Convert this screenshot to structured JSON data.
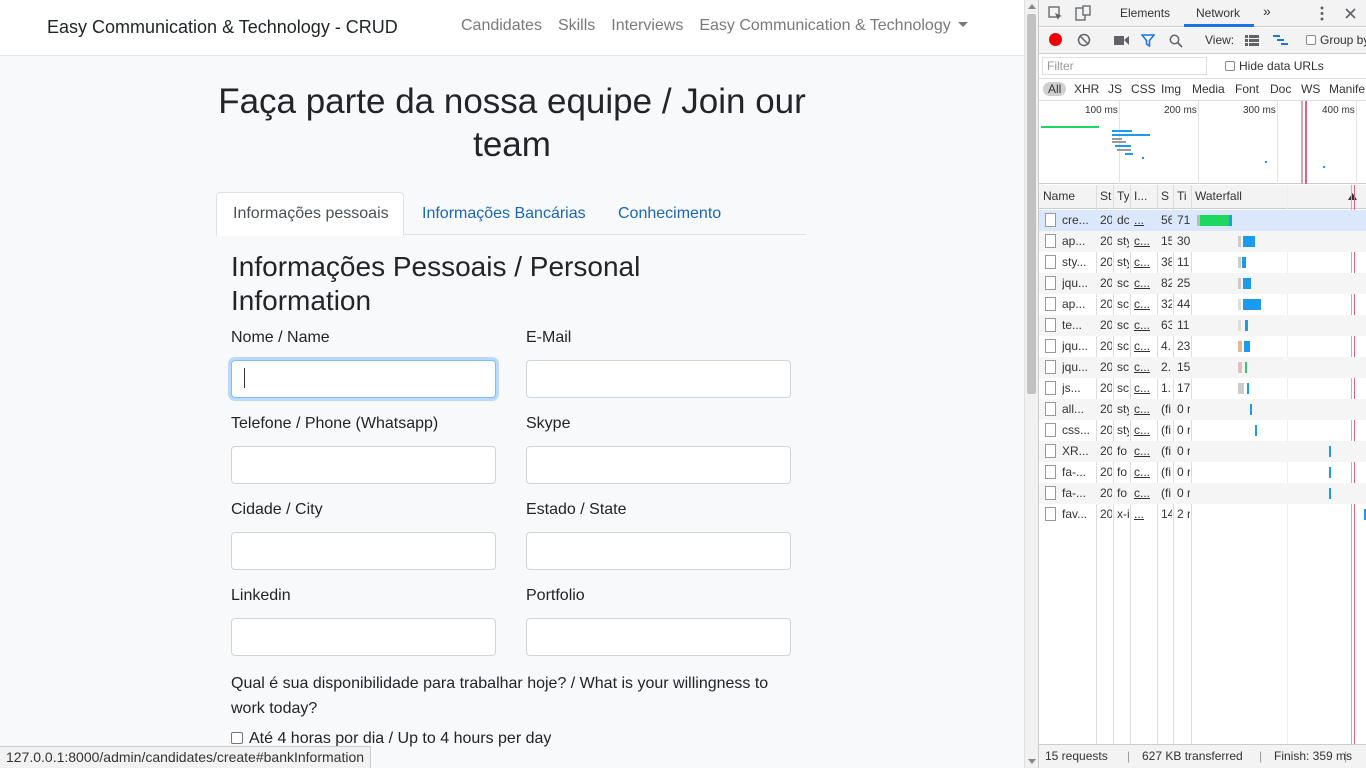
{
  "navbar": {
    "brand": "Easy Communication & Technology - CRUD",
    "links": [
      "Candidates",
      "Skills",
      "Interviews",
      "Easy Communication & Technology"
    ]
  },
  "page_title": "Faça parte da nossa equipe / Join our team",
  "tabs": [
    "Informações pessoais",
    "Informações Bancárias",
    "Conhecimento"
  ],
  "section_title": "Informações Pessoais / Personal Information",
  "fields": {
    "name": {
      "label": "Nome / Name",
      "value": ""
    },
    "email": {
      "label": "E-Mail",
      "value": ""
    },
    "phone": {
      "label": "Telefone / Phone (Whatsapp)",
      "value": ""
    },
    "skype": {
      "label": "Skype",
      "value": ""
    },
    "city": {
      "label": "Cidade / City",
      "value": ""
    },
    "state": {
      "label": "Estado / State",
      "value": ""
    },
    "linkedin": {
      "label": "Linkedin",
      "value": ""
    },
    "portfolio": {
      "label": "Portfolio",
      "value": ""
    }
  },
  "question": "Qual é sua disponibilidade para trabalhar hoje? / What is your willingness to work today?",
  "options": [
    "Até 4 horas por dia / Up to 4 hours per day"
  ],
  "status_url": "127.0.0.1:8000/admin/candidates/create#bankInformation",
  "devtools": {
    "tabs": [
      "Elements",
      "Network"
    ],
    "more": "»",
    "view_label": "View:",
    "group_by": "Group by",
    "filter_placeholder": "Filter",
    "hide_data_urls": "Hide data URLs",
    "type_filters": [
      "All",
      "XHR",
      "JS",
      "CSS",
      "Img",
      "Media",
      "Font",
      "Doc",
      "WS",
      "Manife"
    ],
    "timeline_labels": [
      "100 ms",
      "200 ms",
      "300 ms",
      "400 ms"
    ],
    "columns": [
      "Name",
      "St",
      "Ty",
      "I...",
      "S",
      "Ti",
      "Waterfall"
    ],
    "requests": [
      {
        "name": "cre...",
        "status": "20",
        "type": "dc",
        "initiator": "...",
        "size": "56",
        "time": "71"
      },
      {
        "name": "ap...",
        "status": "20",
        "type": "sty",
        "initiator": "c...",
        "size": "15",
        "time": "30"
      },
      {
        "name": "sty...",
        "status": "20",
        "type": "sty",
        "initiator": "c...",
        "size": "38",
        "time": "11"
      },
      {
        "name": "jqu...",
        "status": "20",
        "type": "sc",
        "initiator": "c...",
        "size": "82",
        "time": "25"
      },
      {
        "name": "ap...",
        "status": "20",
        "type": "sc",
        "initiator": "c...",
        "size": "32",
        "time": "44"
      },
      {
        "name": "te...",
        "status": "20",
        "type": "sc",
        "initiator": "c...",
        "size": "63",
        "time": "11"
      },
      {
        "name": "jqu...",
        "status": "20",
        "type": "sc",
        "initiator": "c...",
        "size": "4.",
        "time": "23"
      },
      {
        "name": "jqu...",
        "status": "20",
        "type": "sc",
        "initiator": "c...",
        "size": "2.",
        "time": "15"
      },
      {
        "name": "js...",
        "status": "20",
        "type": "sc",
        "initiator": "c...",
        "size": "1.",
        "time": "17"
      },
      {
        "name": "all...",
        "status": "20",
        "type": "sty",
        "initiator": "c...",
        "size": "(fi",
        "time": "0 r"
      },
      {
        "name": "css...",
        "status": "20",
        "type": "sty",
        "initiator": "c...",
        "size": "(fi",
        "time": "0 r"
      },
      {
        "name": "XR...",
        "status": "20",
        "type": "fo",
        "initiator": "c...",
        "size": "(fi",
        "time": "0 r"
      },
      {
        "name": "fa-...",
        "status": "20",
        "type": "fo",
        "initiator": "c...",
        "size": "(fi",
        "time": "0 r"
      },
      {
        "name": "fa-...",
        "status": "20",
        "type": "fo",
        "initiator": "c...",
        "size": "(fi",
        "time": "0 r"
      },
      {
        "name": "fav...",
        "status": "20",
        "type": "x-i",
        "initiator": "...",
        "size": "14",
        "time": "2 r"
      }
    ],
    "footer": {
      "requests": "15 requests",
      "transferred": "627 KB transferred",
      "finish": "Finish: 359 ms"
    }
  },
  "colors": {
    "link": "#1a67b8",
    "focus": "#80bdff",
    "record": "#e00000",
    "network_accent": "#1a73e8",
    "waterfall_green": "#1ed760",
    "waterfall_blue": "#1a9bf0"
  }
}
